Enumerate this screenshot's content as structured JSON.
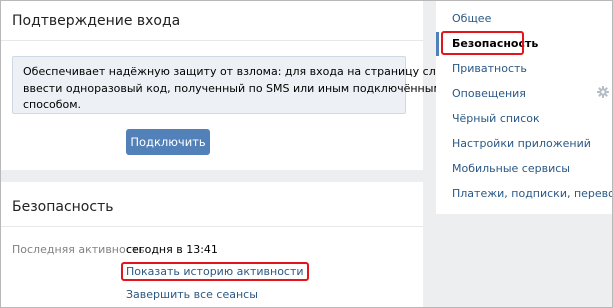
{
  "login_confirmation": {
    "title": "Подтверждение входа",
    "info_lines": [
      "Обеспечивает надёжную защиту от взлома: для входа на страницу следует",
      "ввести одноразовый код, полученный по SMS или иным подключённым",
      "способом."
    ],
    "connect_button": "Подключить"
  },
  "security": {
    "title": "Безопасность",
    "last_activity_label": "Последняя активность",
    "last_activity_value": "сегодня в 13:41",
    "show_history_link": "Показать историю активности",
    "end_sessions_link": "Завершить все сеансы"
  },
  "sidebar": {
    "items": [
      {
        "label": "Общее"
      },
      {
        "label": "Безопасность"
      },
      {
        "label": "Приватность"
      },
      {
        "label": "Оповещения"
      },
      {
        "label": "Чёрный список"
      },
      {
        "label": "Настройки приложений"
      },
      {
        "label": "Мобильные сервисы"
      },
      {
        "label": "Платежи, подписки, переводы"
      }
    ],
    "active_index": 1,
    "gear_icon": "gear-icon"
  },
  "colors": {
    "accent": "#5181b8",
    "link": "#2a5885",
    "highlight_red": "#e2141c",
    "page_bg": "#edeef0"
  }
}
